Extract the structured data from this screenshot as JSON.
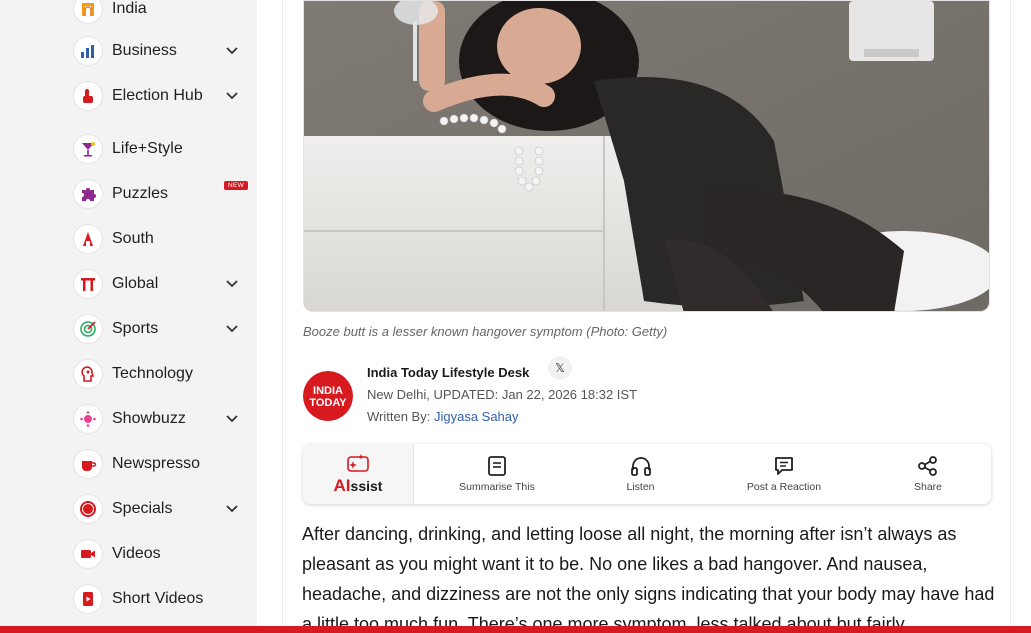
{
  "sidebar": {
    "items": [
      {
        "label": "India",
        "icon": "india-gate-icon",
        "chevron": false
      },
      {
        "label": "Business",
        "icon": "bar-chart-icon",
        "chevron": true
      },
      {
        "label": "Election Hub",
        "icon": "voting-hand-icon",
        "chevron": true
      },
      {
        "label": "Life+Style",
        "icon": "cocktail-icon",
        "chevron": false
      },
      {
        "label": "Puzzles",
        "icon": "puzzle-icon",
        "chevron": false,
        "badge": "NEW"
      },
      {
        "label": "South",
        "icon": "temple-icon",
        "chevron": false
      },
      {
        "label": "Global",
        "icon": "torii-gate-icon",
        "chevron": true
      },
      {
        "label": "Sports",
        "icon": "sports-target-icon",
        "chevron": true
      },
      {
        "label": "Technology",
        "icon": "tech-head-icon",
        "chevron": false
      },
      {
        "label": "Showbuzz",
        "icon": "film-reel-icon",
        "chevron": true
      },
      {
        "label": "Newspresso",
        "icon": "coffee-cup-icon",
        "chevron": false
      },
      {
        "label": "Specials",
        "icon": "specials-seal-icon",
        "chevron": true
      },
      {
        "label": "Videos",
        "icon": "video-camera-icon",
        "chevron": false
      },
      {
        "label": "Short Videos",
        "icon": "phone-play-icon",
        "chevron": false
      }
    ]
  },
  "article": {
    "caption": "Booze butt is a lesser known hangover symptom (Photo: Getty)",
    "author": {
      "name": "India Today Lifestyle Desk",
      "logo_text_line1": "INDIA",
      "logo_text_line2": "TODAY",
      "social": "𝕏"
    },
    "location": "New Delhi,",
    "updated": "UPDATED: Jan 22, 2026 18:32 IST",
    "written_by_label": "Written By:",
    "written_by": "Jigyasa Sahay",
    "actions": {
      "aissist_ai": "AI",
      "aissist_rest": "ssist",
      "summarise": "Summarise This",
      "listen": "Listen",
      "reaction": "Post a Reaction",
      "share": "Share"
    },
    "body": "After dancing, drinking, and letting loose all night, the morning after isn’t always as pleasant as you might want it to be. No one likes a bad hangover. And nausea, headache, and dizziness are not the only signs indicating that your body may have had a little too much fun. There’s one more symptom, less talked about but fairly"
  },
  "colors": {
    "brand_red": "#d71920",
    "link_blue": "#2f5fa8",
    "sidebar_bg": "#f3f3f3"
  }
}
